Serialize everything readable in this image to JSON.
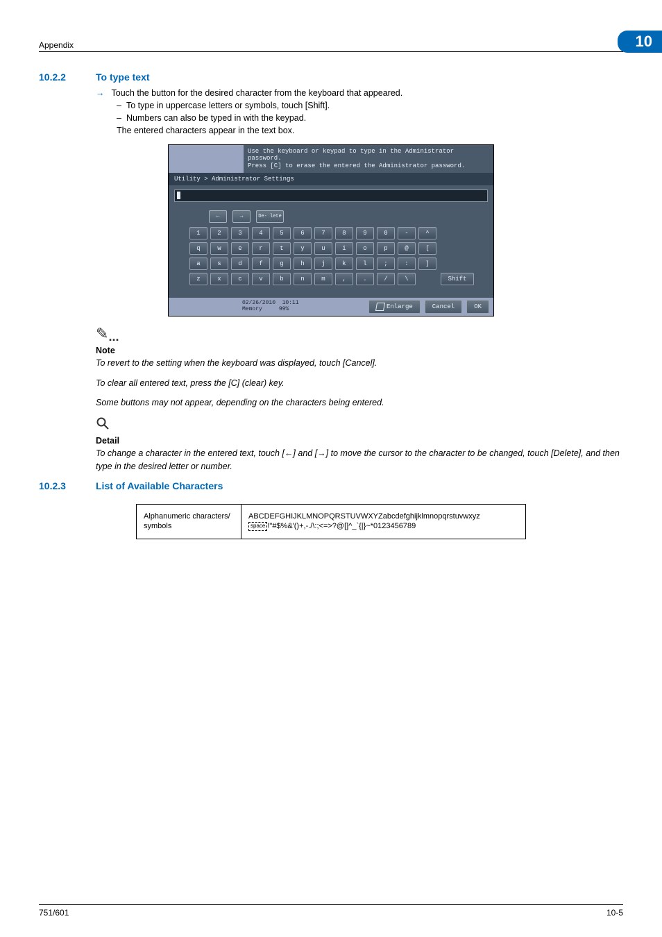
{
  "header": {
    "appendix": "Appendix",
    "chapter": "10"
  },
  "s1": {
    "num": "10.2.2",
    "title": "To type text",
    "step_arrow": "→",
    "step": "Touch the button for the desired character from the keyboard that appeared.",
    "sub1": "To type in uppercase letters or symbols, touch [Shift].",
    "sub2": "Numbers can also be typed in with the keypad.",
    "after": "The entered characters appear in the text box."
  },
  "panel": {
    "msg1": "Use the keyboard or keypad to type in the Administrator password.",
    "msg2": "Press [C] to erase the entered the Administrator password.",
    "breadcrumb": "Utility > Administrator Settings",
    "arrow_left_label": "←",
    "arrow_right_label": "→",
    "delete_label": "De-\nlete",
    "row1": [
      "1",
      "2",
      "3",
      "4",
      "5",
      "6",
      "7",
      "8",
      "9",
      "0",
      "-",
      "^"
    ],
    "row2": [
      "q",
      "w",
      "e",
      "r",
      "t",
      "y",
      "u",
      "i",
      "o",
      "p",
      "@",
      "["
    ],
    "row3": [
      "a",
      "s",
      "d",
      "f",
      "g",
      "h",
      "j",
      "k",
      "l",
      ";",
      ":",
      "]"
    ],
    "row4": [
      "z",
      "x",
      "c",
      "v",
      "b",
      "n",
      "m",
      ",",
      ".",
      "/",
      "\\"
    ],
    "shift": "Shift",
    "status_date": "02/26/2010",
    "status_time": "10:11",
    "status_mem": "Memory",
    "status_pct": "99%",
    "enlarge": "Enlarge",
    "cancel": "Cancel",
    "ok": "OK"
  },
  "note": {
    "head": "Note",
    "p1": "To revert to the setting when the keyboard was displayed, touch [Cancel].",
    "p2": "To clear all entered text, press the [C] (clear) key.",
    "p3": "Some buttons may not appear, depending on the characters being entered."
  },
  "detail": {
    "head": "Detail",
    "p1": "To change a character in the entered text, touch [←] and [→] to move the cursor to the character to be changed, touch [Delete], and then type in the desired letter or number."
  },
  "s2": {
    "num": "10.2.3",
    "title": "List of Available Characters"
  },
  "chars": {
    "label": "Alphanumeric characters/ symbols",
    "line1": "ABCDEFGHIJKLMNOPQRSTUVWXYZabcdefghijklmnopqrstuvwxyz",
    "space_label": "space",
    "line2_rest": "!\"#$%&'()+,-./\\:;<=>?@[]^_`{|}~*0123456789"
  },
  "footer": {
    "left": "751/601",
    "right": "10-5"
  }
}
